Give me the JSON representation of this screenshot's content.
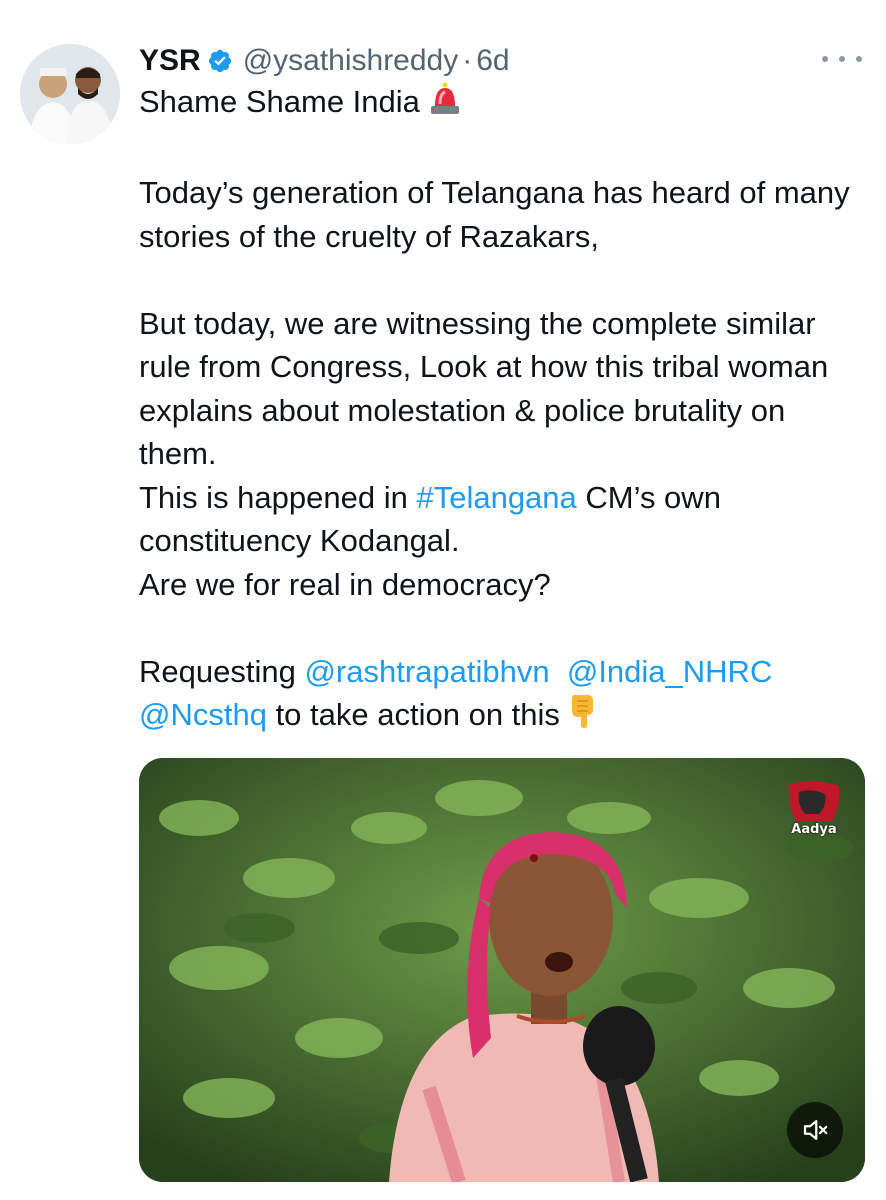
{
  "tweet": {
    "author": {
      "display_name": "YSR",
      "handle": "@ysathishreddy",
      "verified": true,
      "avatar_icon": "profile-avatar"
    },
    "separator": "·",
    "timestamp": "6d",
    "more_icon": "ellipsis-icon",
    "text": {
      "line1": "Shame Shame India",
      "para1": "Today’s generation of Telangana has heard of many stories of the cruelty of Razakars,",
      "para2": "But today, we are witnessing the complete similar rule from Congress, Look at how this tribal woman explains about molestation & police brutality on them.",
      "line_happened_prefix": "This is happened in ",
      "hashtag": "#Telangana",
      "line_happened_suffix": " CM’s own constituency Kodangal.",
      "line_real": "Are we for real in democracy?",
      "requesting": "Requesting ",
      "mention1": "@rashtrapatibhvn",
      "mention2": "@India_NHRC",
      "mention3": "@Ncsthq",
      "closing": " to take action on this"
    },
    "emojis": {
      "siren": "police-siren-emoji",
      "pointing": "pointing-down-emoji"
    },
    "media": {
      "type": "video",
      "watermark_text": "Aadya",
      "mute_icon": "volume-muted-icon"
    }
  },
  "colors": {
    "text": "#0f1419",
    "secondary": "#536471",
    "link": "#1d9bf0",
    "verified": "#1d9bf0"
  }
}
